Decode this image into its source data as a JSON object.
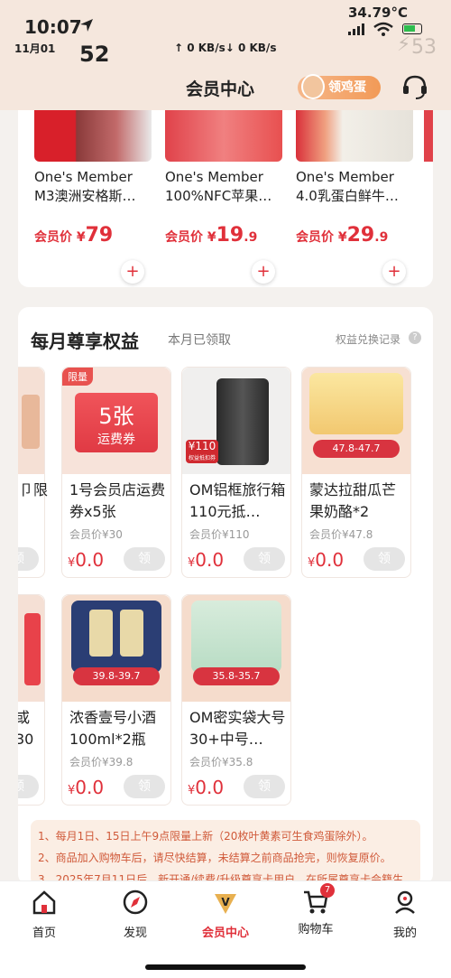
{
  "status_bar": {
    "time": "10:07",
    "date": "11月01",
    "number": "52",
    "network": "↑ 0 KB/s↓ 0 KB/s",
    "temperature": "34.79°C",
    "battery_label": "53"
  },
  "header": {
    "title": "会员中心",
    "egg_button": "领鸡蛋"
  },
  "products": [
    {
      "line1": "One's Member",
      "line2": "M3澳洲安格斯…",
      "price_label": "会员价",
      "currency": "¥",
      "price_int": "79",
      "price_dec": ""
    },
    {
      "line1": "One's Member",
      "line2": "100%NFC苹果…",
      "price_label": "会员价",
      "currency": "¥",
      "price_int": "19",
      "price_dec": ".9"
    },
    {
      "line1": "One's Member",
      "line2": "4.0乳蛋白鲜牛…",
      "price_label": "会员价",
      "currency": "¥",
      "price_int": "29",
      "price_dec": ".9"
    }
  ],
  "benefits": {
    "title": "每月尊享权益",
    "subtitle": "本月已领取",
    "link": "权益兑换记录",
    "partial_left": [
      "卩限",
      "或30",
      "券"
    ],
    "items": [
      {
        "tag": "限量",
        "name": "1号会员店运费券x5张",
        "member_price": "会员价¥30",
        "price": "0.0",
        "img_text1": "5张",
        "img_text2": "运费券",
        "button": "领"
      },
      {
        "tag": "",
        "name": "OM铝框旅行箱110元抵…",
        "member_price": "会员价¥110",
        "price": "0.0",
        "img_text1": "¥110",
        "img_text2": "权益抵扣券",
        "button": "领"
      },
      {
        "tag": "",
        "name": "蒙达拉甜瓜芒果奶酪*2",
        "member_price": "会员价¥47.8",
        "price": "0.0",
        "img_text1": "47.8-47.7",
        "img_text2": "",
        "button": "领"
      },
      {
        "tag": "",
        "name": "浓香壹号小酒100ml*2瓶",
        "member_price": "会员价¥39.8",
        "price": "0.0",
        "img_text1": "39.8-39.7",
        "img_text2": "",
        "button": "领"
      },
      {
        "tag": "",
        "name": "OM密实袋大号30+中号…",
        "member_price": "会员价¥35.8",
        "price": "0.0",
        "img_text1": "35.8-35.7",
        "img_text2": "",
        "button": "领"
      }
    ],
    "currency": "¥",
    "partial_button": "领"
  },
  "notes": [
    "1、每月1日、15日上午9点限量上新（20枚叶黄素可生食鸡蛋除外）。",
    "2、商品加入购物车后，请尽快结算，未结算之前商品抢完，则恢复原价。",
    "3、2025年7月11日后，新开通/续费/升级尊享卡用户，在所属尊享卡会籍生"
  ],
  "nav": [
    {
      "label": "首页",
      "icon": "home-icon"
    },
    {
      "label": "发现",
      "icon": "discover-icon"
    },
    {
      "label": "会员中心",
      "icon": "member-icon"
    },
    {
      "label": "购物车",
      "icon": "cart-icon",
      "badge": "7"
    },
    {
      "label": "我的",
      "icon": "profile-icon"
    }
  ],
  "colors": {
    "accent": "#e0303a",
    "header_bg": "#f5e7dd",
    "egg_button": "#f29a57"
  }
}
